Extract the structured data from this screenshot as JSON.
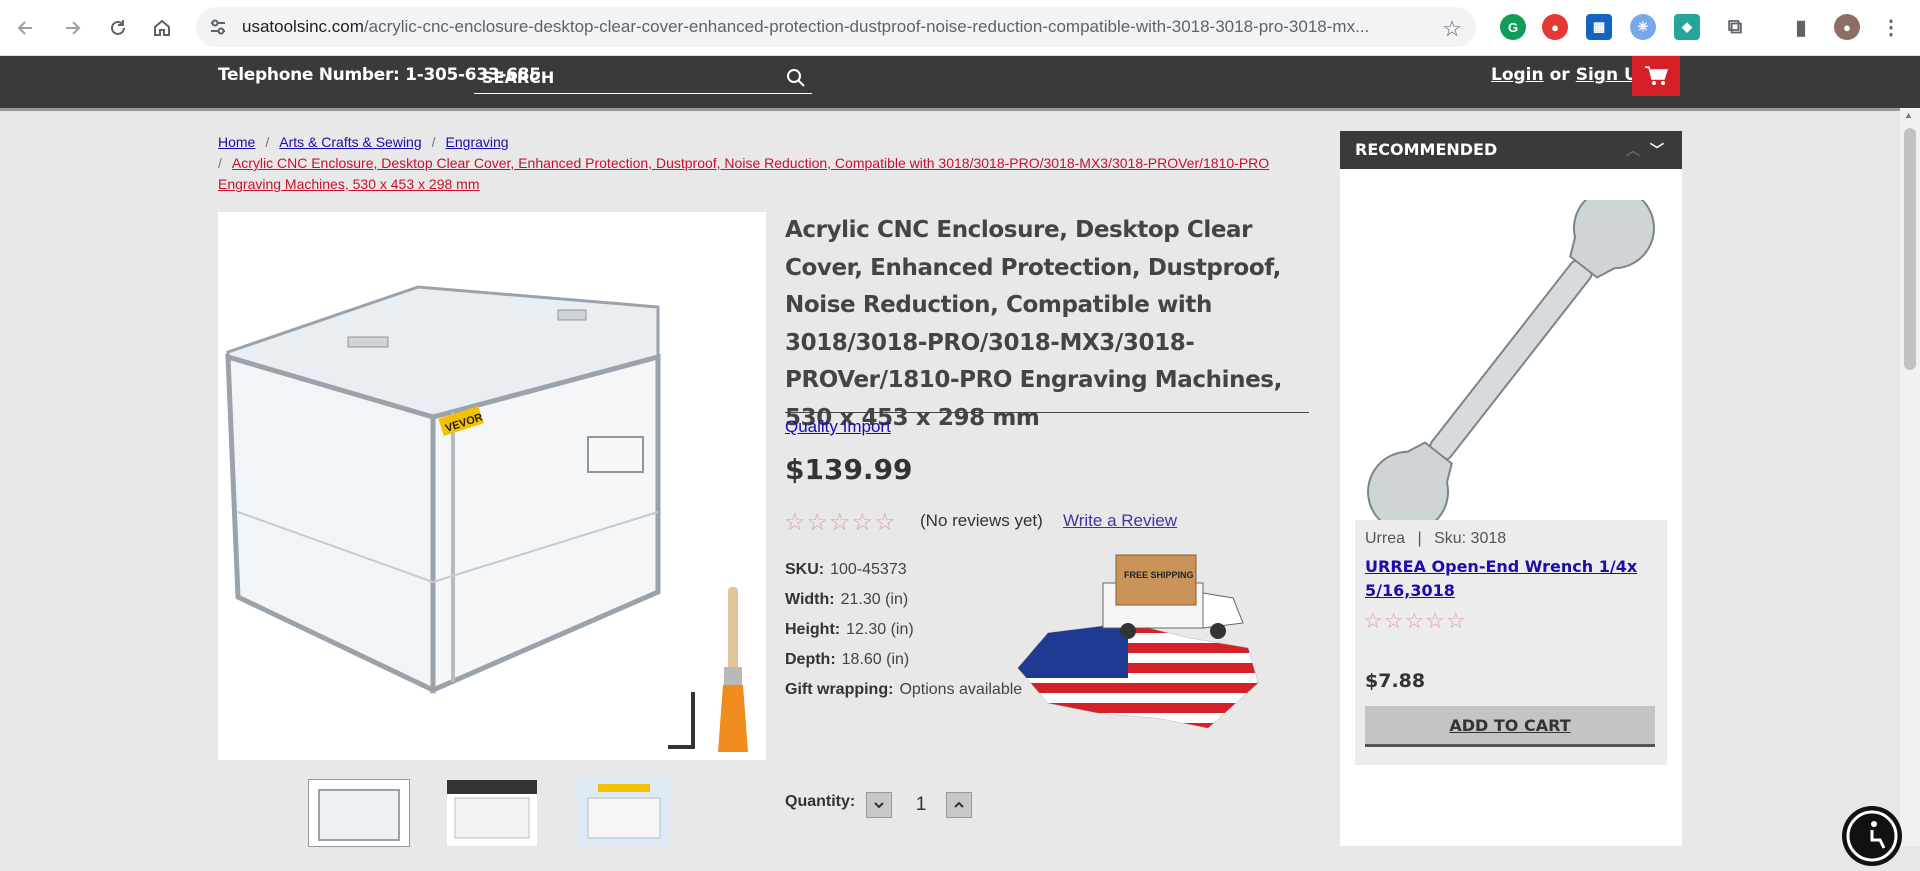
{
  "browser": {
    "url_host": "usatoolsinc.com",
    "url_path": "/acrylic-cnc-enclosure-desktop-clear-cover-enhanced-protection-dustproof-noise-reduction-compatible-with-3018-3018-pro-3018-mx..."
  },
  "header": {
    "phone": "Telephone Number: 1-305-633-685",
    "search_placeholder": "SEARCH",
    "login": "Login",
    "or": "or",
    "signup": "Sign Up"
  },
  "breadcrumbs": {
    "home": "Home",
    "cat1": "Arts & Crafts & Sewing",
    "cat2": "Engraving",
    "current": "Acrylic CNC Enclosure, Desktop Clear Cover, Enhanced Protection, Dustproof, Noise Reduction, Compatible with 3018/3018-PRO/3018-MX3/3018-PROVer/1810-PRO Engraving Machines, 530 x 453 x 298 mm"
  },
  "product": {
    "title": "Acrylic CNC Enclosure, Desktop Clear Cover, Enhanced Protection, Dustproof, Noise Reduction, Compatible with 3018/3018-PRO/3018-MX3/3018-PROVer/1810-PRO Engraving Machines, 530 x 453 x 298 mm",
    "brand": "Quality Import",
    "price": "$139.99",
    "stars": "☆☆☆☆☆",
    "reviews": "(No reviews yet)",
    "write_review": "Write a Review",
    "specs": [
      {
        "label": "SKU:",
        "value": "100-45373"
      },
      {
        "label": "Width:",
        "value": "21.30 (in)"
      },
      {
        "label": "Height:",
        "value": "12.30 (in)"
      },
      {
        "label": "Depth:",
        "value": "18.60 (in)"
      },
      {
        "label": "Gift wrapping:",
        "value": "Options available"
      }
    ],
    "badge_text": "FREE SHIPPING",
    "image_logo": "VEVOR",
    "quantity_label": "Quantity:",
    "quantity": "1"
  },
  "recommended": {
    "title": "RECOMMENDED",
    "item": {
      "brand": "Urrea",
      "sep": "|",
      "sku": "Sku: 3018",
      "name": "URREA Open-End Wrench 1/4x 5/16,3018",
      "stars": "☆☆☆☆☆",
      "price": "$7.88",
      "add_to_cart": "ADD TO CART"
    }
  },
  "colors": {
    "header_bg": "#3a3a3a",
    "cart_red": "#d62027",
    "link": "#1a0dab",
    "crumb_current": "#c8102e"
  }
}
